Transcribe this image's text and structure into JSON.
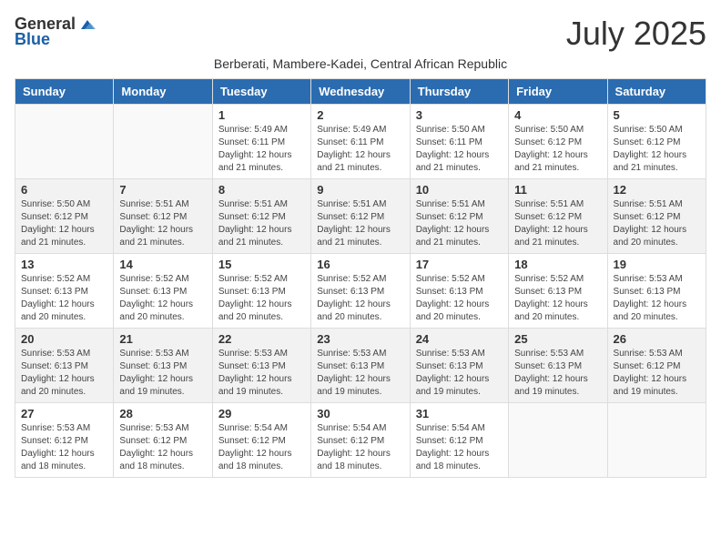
{
  "logo": {
    "general": "General",
    "blue": "Blue"
  },
  "title": "July 2025",
  "location": "Berberati, Mambere-Kadei, Central African Republic",
  "days_of_week": [
    "Sunday",
    "Monday",
    "Tuesday",
    "Wednesday",
    "Thursday",
    "Friday",
    "Saturday"
  ],
  "weeks": [
    [
      {
        "day": "",
        "sunrise": "",
        "sunset": "",
        "daylight": "",
        "empty": true
      },
      {
        "day": "",
        "sunrise": "",
        "sunset": "",
        "daylight": "",
        "empty": true
      },
      {
        "day": "1",
        "sunrise": "Sunrise: 5:49 AM",
        "sunset": "Sunset: 6:11 PM",
        "daylight": "Daylight: 12 hours and 21 minutes.",
        "empty": false
      },
      {
        "day": "2",
        "sunrise": "Sunrise: 5:49 AM",
        "sunset": "Sunset: 6:11 PM",
        "daylight": "Daylight: 12 hours and 21 minutes.",
        "empty": false
      },
      {
        "day": "3",
        "sunrise": "Sunrise: 5:50 AM",
        "sunset": "Sunset: 6:11 PM",
        "daylight": "Daylight: 12 hours and 21 minutes.",
        "empty": false
      },
      {
        "day": "4",
        "sunrise": "Sunrise: 5:50 AM",
        "sunset": "Sunset: 6:12 PM",
        "daylight": "Daylight: 12 hours and 21 minutes.",
        "empty": false
      },
      {
        "day": "5",
        "sunrise": "Sunrise: 5:50 AM",
        "sunset": "Sunset: 6:12 PM",
        "daylight": "Daylight: 12 hours and 21 minutes.",
        "empty": false
      }
    ],
    [
      {
        "day": "6",
        "sunrise": "Sunrise: 5:50 AM",
        "sunset": "Sunset: 6:12 PM",
        "daylight": "Daylight: 12 hours and 21 minutes.",
        "empty": false
      },
      {
        "day": "7",
        "sunrise": "Sunrise: 5:51 AM",
        "sunset": "Sunset: 6:12 PM",
        "daylight": "Daylight: 12 hours and 21 minutes.",
        "empty": false
      },
      {
        "day": "8",
        "sunrise": "Sunrise: 5:51 AM",
        "sunset": "Sunset: 6:12 PM",
        "daylight": "Daylight: 12 hours and 21 minutes.",
        "empty": false
      },
      {
        "day": "9",
        "sunrise": "Sunrise: 5:51 AM",
        "sunset": "Sunset: 6:12 PM",
        "daylight": "Daylight: 12 hours and 21 minutes.",
        "empty": false
      },
      {
        "day": "10",
        "sunrise": "Sunrise: 5:51 AM",
        "sunset": "Sunset: 6:12 PM",
        "daylight": "Daylight: 12 hours and 21 minutes.",
        "empty": false
      },
      {
        "day": "11",
        "sunrise": "Sunrise: 5:51 AM",
        "sunset": "Sunset: 6:12 PM",
        "daylight": "Daylight: 12 hours and 21 minutes.",
        "empty": false
      },
      {
        "day": "12",
        "sunrise": "Sunrise: 5:51 AM",
        "sunset": "Sunset: 6:12 PM",
        "daylight": "Daylight: 12 hours and 20 minutes.",
        "empty": false
      }
    ],
    [
      {
        "day": "13",
        "sunrise": "Sunrise: 5:52 AM",
        "sunset": "Sunset: 6:13 PM",
        "daylight": "Daylight: 12 hours and 20 minutes.",
        "empty": false
      },
      {
        "day": "14",
        "sunrise": "Sunrise: 5:52 AM",
        "sunset": "Sunset: 6:13 PM",
        "daylight": "Daylight: 12 hours and 20 minutes.",
        "empty": false
      },
      {
        "day": "15",
        "sunrise": "Sunrise: 5:52 AM",
        "sunset": "Sunset: 6:13 PM",
        "daylight": "Daylight: 12 hours and 20 minutes.",
        "empty": false
      },
      {
        "day": "16",
        "sunrise": "Sunrise: 5:52 AM",
        "sunset": "Sunset: 6:13 PM",
        "daylight": "Daylight: 12 hours and 20 minutes.",
        "empty": false
      },
      {
        "day": "17",
        "sunrise": "Sunrise: 5:52 AM",
        "sunset": "Sunset: 6:13 PM",
        "daylight": "Daylight: 12 hours and 20 minutes.",
        "empty": false
      },
      {
        "day": "18",
        "sunrise": "Sunrise: 5:52 AM",
        "sunset": "Sunset: 6:13 PM",
        "daylight": "Daylight: 12 hours and 20 minutes.",
        "empty": false
      },
      {
        "day": "19",
        "sunrise": "Sunrise: 5:53 AM",
        "sunset": "Sunset: 6:13 PM",
        "daylight": "Daylight: 12 hours and 20 minutes.",
        "empty": false
      }
    ],
    [
      {
        "day": "20",
        "sunrise": "Sunrise: 5:53 AM",
        "sunset": "Sunset: 6:13 PM",
        "daylight": "Daylight: 12 hours and 20 minutes.",
        "empty": false
      },
      {
        "day": "21",
        "sunrise": "Sunrise: 5:53 AM",
        "sunset": "Sunset: 6:13 PM",
        "daylight": "Daylight: 12 hours and 19 minutes.",
        "empty": false
      },
      {
        "day": "22",
        "sunrise": "Sunrise: 5:53 AM",
        "sunset": "Sunset: 6:13 PM",
        "daylight": "Daylight: 12 hours and 19 minutes.",
        "empty": false
      },
      {
        "day": "23",
        "sunrise": "Sunrise: 5:53 AM",
        "sunset": "Sunset: 6:13 PM",
        "daylight": "Daylight: 12 hours and 19 minutes.",
        "empty": false
      },
      {
        "day": "24",
        "sunrise": "Sunrise: 5:53 AM",
        "sunset": "Sunset: 6:13 PM",
        "daylight": "Daylight: 12 hours and 19 minutes.",
        "empty": false
      },
      {
        "day": "25",
        "sunrise": "Sunrise: 5:53 AM",
        "sunset": "Sunset: 6:13 PM",
        "daylight": "Daylight: 12 hours and 19 minutes.",
        "empty": false
      },
      {
        "day": "26",
        "sunrise": "Sunrise: 5:53 AM",
        "sunset": "Sunset: 6:12 PM",
        "daylight": "Daylight: 12 hours and 19 minutes.",
        "empty": false
      }
    ],
    [
      {
        "day": "27",
        "sunrise": "Sunrise: 5:53 AM",
        "sunset": "Sunset: 6:12 PM",
        "daylight": "Daylight: 12 hours and 18 minutes.",
        "empty": false
      },
      {
        "day": "28",
        "sunrise": "Sunrise: 5:53 AM",
        "sunset": "Sunset: 6:12 PM",
        "daylight": "Daylight: 12 hours and 18 minutes.",
        "empty": false
      },
      {
        "day": "29",
        "sunrise": "Sunrise: 5:54 AM",
        "sunset": "Sunset: 6:12 PM",
        "daylight": "Daylight: 12 hours and 18 minutes.",
        "empty": false
      },
      {
        "day": "30",
        "sunrise": "Sunrise: 5:54 AM",
        "sunset": "Sunset: 6:12 PM",
        "daylight": "Daylight: 12 hours and 18 minutes.",
        "empty": false
      },
      {
        "day": "31",
        "sunrise": "Sunrise: 5:54 AM",
        "sunset": "Sunset: 6:12 PM",
        "daylight": "Daylight: 12 hours and 18 minutes.",
        "empty": false
      },
      {
        "day": "",
        "sunrise": "",
        "sunset": "",
        "daylight": "",
        "empty": true
      },
      {
        "day": "",
        "sunrise": "",
        "sunset": "",
        "daylight": "",
        "empty": true
      }
    ]
  ]
}
